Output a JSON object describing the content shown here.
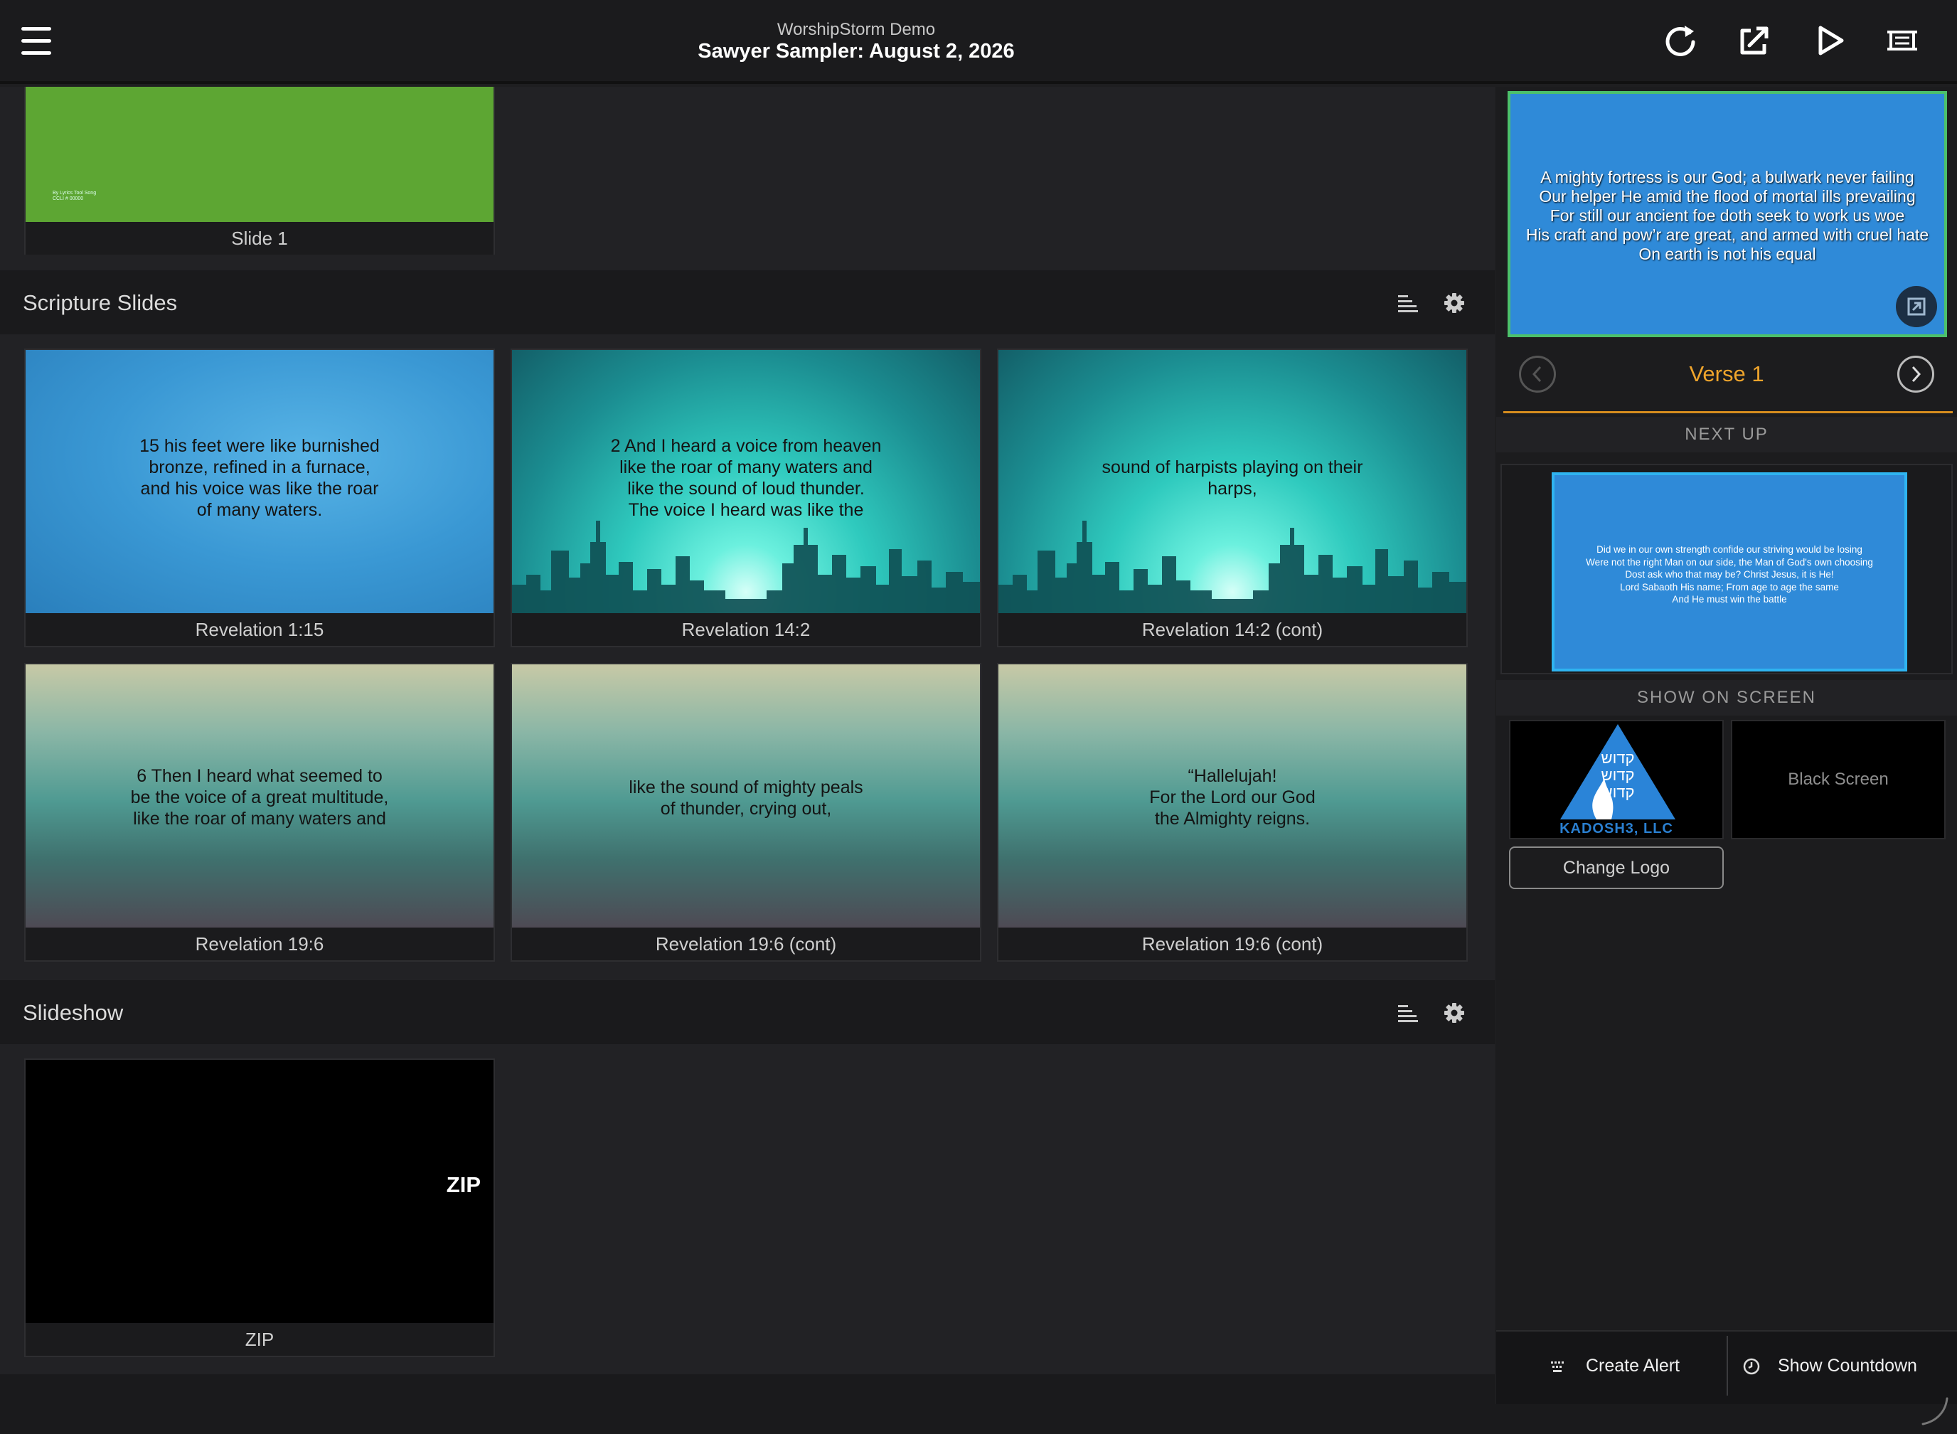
{
  "header": {
    "subtitle": "WorshipStorm Demo",
    "title": "Sawyer Sampler: August 2, 2026",
    "icons": [
      "menu-icon",
      "refresh-icon",
      "external-edit-icon",
      "play-icon",
      "output-screen-icon"
    ]
  },
  "top_partial": {
    "slide_label": "Slide 1",
    "slide_credit": "By Lyrics Tool Song\nCCLI # 00000"
  },
  "scripture": {
    "title": "Scripture Slides",
    "slides": [
      {
        "label": "Revelation 1:15",
        "text": "15 his feet were like burnished\nbronze, refined in a furnace,\nand his voice was like the roar\nof many waters."
      },
      {
        "label": "Revelation 14:2",
        "text": "2 And I heard a voice from heaven\nlike the roar of many waters and\nlike the sound of loud thunder.\nThe voice I heard was like the"
      },
      {
        "label": "Revelation 14:2 (cont)",
        "text": "sound of harpists playing on their\nharps,"
      },
      {
        "label": "Revelation 19:6",
        "text": "6 Then I heard what seemed to\nbe the voice of a great multitude,\nlike the roar of many waters and"
      },
      {
        "label": "Revelation 19:6 (cont)",
        "text": "like the sound of mighty peals\nof thunder, crying out,"
      },
      {
        "label": "Revelation 19:6 (cont)",
        "text": "“Hallelujah!\nFor the Lord our God\nthe Almighty reigns."
      }
    ]
  },
  "slideshow": {
    "title": "Slideshow",
    "slides": [
      {
        "label": "ZIP",
        "badge": "ZIP"
      }
    ]
  },
  "live": {
    "text": "A mighty fortress is our God; a bulwark never failing\nOur helper He amid the flood of mortal ills prevailing\nFor still our ancient foe doth seek to work us woe\nHis craft and pow’r are great, and armed with cruel hate\nOn earth is not his equal",
    "verse": "Verse 1"
  },
  "next_up": {
    "heading": "NEXT UP",
    "text": "Did we in our own strength confide our striving would be losing\nWere not the right Man on our side, the Man of God's own choosing\nDost ask who that may be? Christ Jesus, it is He!\nLord Sabaoth His name; From age to age the same\nAnd He must win the battle"
  },
  "show_on_screen": {
    "heading": "SHOW ON SCREEN",
    "logo_caption": "KADOSH3, LLC",
    "logo_lines": [
      "קדוש",
      "קדוש",
      "קדוש"
    ],
    "black_screen": "Black Screen",
    "change_logo": "Change Logo"
  },
  "bottom": {
    "create_alert": "Create Alert",
    "show_countdown": "Show Countdown"
  },
  "colors": {
    "accent": "#f0a52c",
    "live_border": "#4cc06b",
    "next_border": "#2fb4f0",
    "slide_blue": "#2f8ad8",
    "green_slide": "#5da633"
  }
}
